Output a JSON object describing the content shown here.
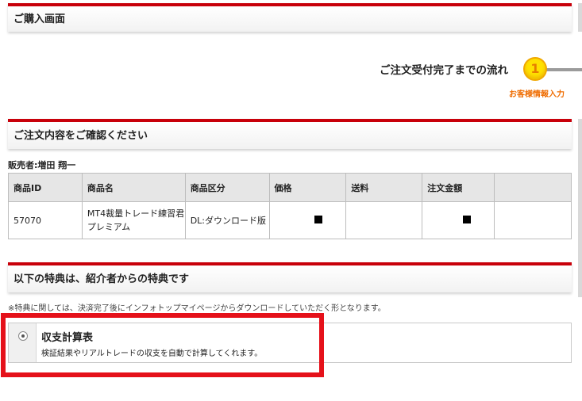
{
  "purchase_header": {
    "title": "ご購入画面"
  },
  "flow": {
    "title": "ご注文受付完了までの流れ",
    "step_number": "1",
    "step_label": "お客様情報入力"
  },
  "confirm_header": {
    "title": "ご注文内容をご確認ください"
  },
  "seller": {
    "label": "販売者:増田 翔一"
  },
  "product_table": {
    "headers": [
      "商品ID",
      "商品名",
      "商品区分",
      "価格",
      "送料",
      "注文金額",
      ""
    ],
    "row": {
      "id": "57070",
      "name": "MT4裁量トレード練習君プレミアム",
      "category": "DL:ダウンロード版"
    }
  },
  "benefit_header": {
    "title": "以下の特典は、紹介者からの特典です"
  },
  "benefit_note": "※特典に関しては、決済完了後にインフォトップマイページからダウンロードしていただく形となります。",
  "benefit": {
    "title": "収支計算表",
    "description": "検証結果やリアルトレードの収支を自動で計算してくれます。",
    "selected": true
  },
  "colors": {
    "accent_red": "#c8000a",
    "highlight_red": "#e5111a",
    "step_yellow": "#ffe100",
    "step_label_orange": "#ef6c00"
  }
}
